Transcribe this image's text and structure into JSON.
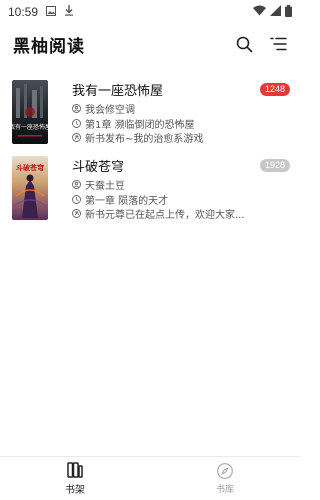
{
  "status_bar": {
    "time": "10:59"
  },
  "header": {
    "title": "黑柚阅读"
  },
  "books": [
    {
      "title": "我有一座恐怖屋",
      "author": "我会修空调",
      "chapter": "第1章 濒临倒闭的恐怖屋",
      "update": "新书发布~我的治愈系游戏",
      "badge": "1248",
      "badge_color": "#e53935",
      "cover_text": "我有一座恐怖屋"
    },
    {
      "title": "斗破苍穹",
      "author": "天蚕土豆",
      "chapter": "第一章 陨落的天才",
      "update": "新书元尊已在起点上传，欢迎大家...",
      "badge": "1928",
      "badge_color": "#c8c8c8",
      "cover_text": "斗破苍穹"
    }
  ],
  "bottom_nav": {
    "bookshelf_label": "书架",
    "library_label": "书库"
  }
}
